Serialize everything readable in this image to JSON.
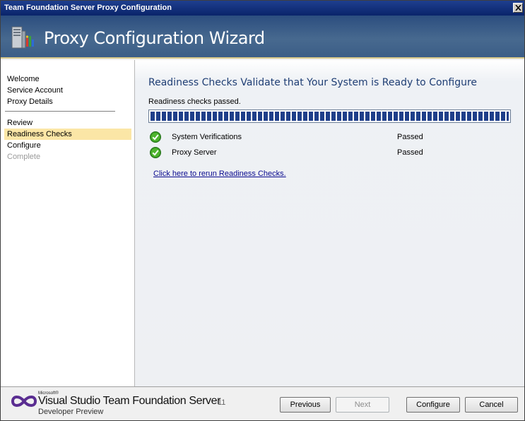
{
  "window": {
    "title": "Team Foundation Server Proxy Configuration"
  },
  "banner": {
    "title": "Proxy Configuration Wizard",
    "icon": "server-icon"
  },
  "sidebar": {
    "items": [
      {
        "label": "Welcome",
        "state": "normal"
      },
      {
        "label": "Service Account",
        "state": "normal"
      },
      {
        "label": "Proxy Details",
        "state": "normal"
      },
      {
        "label": "Review",
        "state": "normal"
      },
      {
        "label": "Readiness Checks",
        "state": "active"
      },
      {
        "label": "Configure",
        "state": "normal"
      },
      {
        "label": "Complete",
        "state": "disabled"
      }
    ],
    "active_color": "#fbe6a6"
  },
  "main": {
    "heading": "Readiness Checks Validate that Your System is Ready to Configure",
    "status": "Readiness checks passed.",
    "progress": 1.0,
    "checks": [
      {
        "name": "System Verifications",
        "status": "Passed",
        "icon": "check-circle-icon"
      },
      {
        "name": "Proxy Server",
        "status": "Passed",
        "icon": "check-circle-icon"
      }
    ],
    "rerun_link": "Click here to rerun Readiness Checks."
  },
  "footer": {
    "logo_microsoft": "Microsoft®",
    "logo_product": "Visual Studio Team Foundation Server",
    "logo_version": "11",
    "logo_subtitle": "Developer Preview",
    "buttons": {
      "previous": "Previous",
      "next": "Next",
      "configure": "Configure",
      "cancel": "Cancel"
    }
  },
  "colors": {
    "banner": "#3b5d86",
    "heading": "#1f3e74",
    "progress": "#1f3f8a",
    "check": "#3a9a22",
    "link": "#0a0a8f"
  }
}
